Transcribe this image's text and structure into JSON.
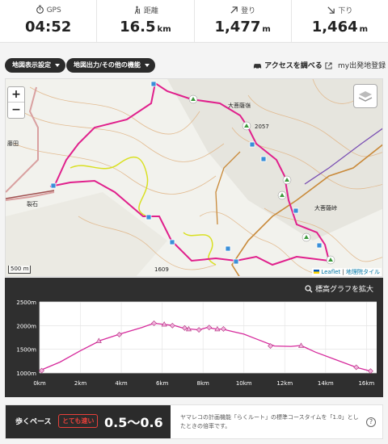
{
  "stats": [
    {
      "label": "GPS",
      "value": "04:52",
      "unit": "",
      "icon": "stopwatch-icon"
    },
    {
      "label": "距離",
      "value": "16.5",
      "unit": "km",
      "icon": "hiker-icon"
    },
    {
      "label": "登り",
      "value": "1,477",
      "unit": "m",
      "icon": "arrow-up-right-icon"
    },
    {
      "label": "下り",
      "value": "1,464",
      "unit": "m",
      "icon": "arrow-down-right-icon"
    }
  ],
  "toolbar": {
    "map_display": "地図表示設定",
    "map_output": "地図出力/その他の機能",
    "access": "アクセスを調べる",
    "register": "my出発地登録"
  },
  "map": {
    "labels": {
      "peak1": "大菩薩嶺",
      "elev1": "2057",
      "pass": "大菩薩峠",
      "place1": "裂石",
      "place2": "藤田",
      "elev2": "1609"
    },
    "scale": "500 m",
    "attribution_leaflet": "Leaflet",
    "attribution_gsi": "地理院タイル",
    "zoom_in": "+",
    "zoom_out": "−",
    "colors": {
      "route": "#e0208c",
      "checkpoint": "#3a8fd8",
      "contour": "#c98a3a"
    }
  },
  "elevation": {
    "expand_label": "標高グラフを拡大"
  },
  "chart_data": {
    "type": "line",
    "title": "",
    "xlabel": "",
    "ylabel": "",
    "x_ticks": [
      "0km",
      "2km",
      "4km",
      "6km",
      "8km",
      "10km",
      "12km",
      "14km",
      "16km"
    ],
    "y_ticks": [
      "1000m",
      "1500m",
      "2000m",
      "2500m"
    ],
    "xlim": [
      0,
      16.5
    ],
    "ylim": [
      1000,
      2500
    ],
    "x": [
      0,
      1,
      2,
      3,
      4,
      5,
      5.6,
      6,
      6.6,
      7,
      7.3,
      7.8,
      8.2,
      8.6,
      9,
      9.5,
      10,
      10.6,
      11.5,
      12.3,
      12.8,
      13.5,
      14.5,
      15.5,
      16.2
    ],
    "y": [
      1050,
      1230,
      1470,
      1690,
      1830,
      1960,
      2050,
      2030,
      2000,
      1950,
      1930,
      1910,
      1960,
      1930,
      1920,
      1870,
      1820,
      1720,
      1570,
      1560,
      1580,
      1440,
      1280,
      1120,
      1040
    ],
    "markers_x": [
      0.1,
      2.9,
      3.9,
      5.6,
      6.1,
      6.5,
      7.1,
      7.3,
      7.8,
      8.3,
      8.7,
      9.0,
      11.3,
      12.8,
      15.5,
      16.2
    ],
    "markers_y": [
      1050,
      1680,
      1810,
      2050,
      2030,
      2000,
      1950,
      1930,
      1910,
      1960,
      1930,
      1930,
      1570,
      1580,
      1120,
      1040
    ],
    "color": "#d62a9c",
    "grid": true
  },
  "pace": {
    "label": "歩くペース",
    "badge": "とても速い",
    "value": "0.5〜0.6",
    "note": "ヤマレコの計画機能「らくルート」の標準コースタイムを「1.0」としたときの倍率です。",
    "help": "?"
  }
}
